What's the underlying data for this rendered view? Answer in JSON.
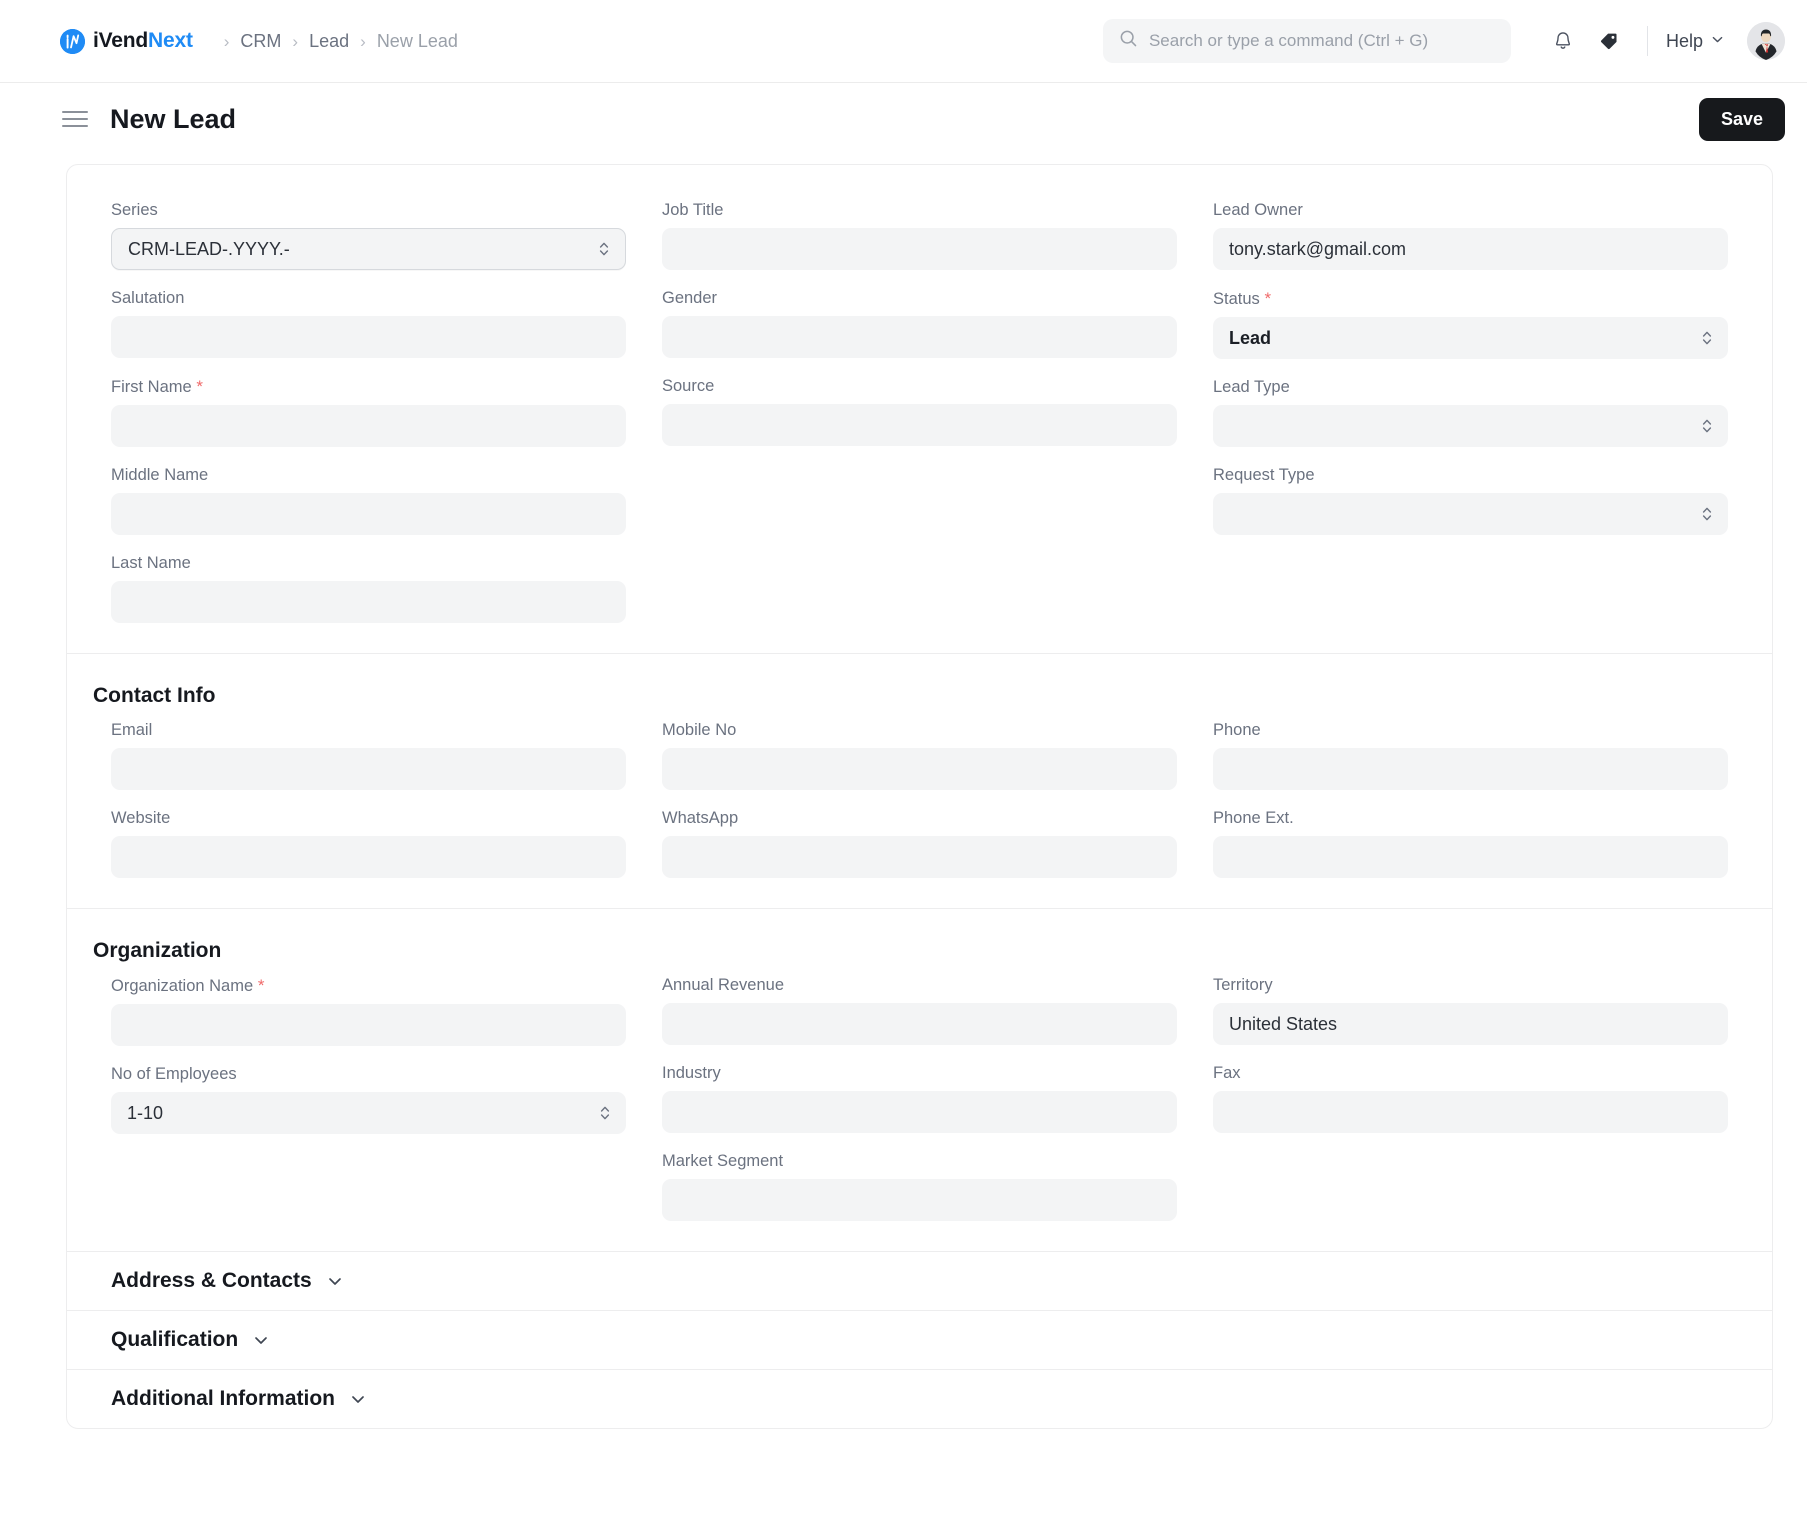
{
  "topnav": {
    "brand": {
      "dark": "iVend",
      "blue": "Next",
      "mark": "logo-icon"
    },
    "breadcrumbs": [
      {
        "label": "CRM",
        "current": false
      },
      {
        "label": "Lead",
        "current": false
      },
      {
        "label": "New Lead",
        "current": true
      }
    ],
    "separator": "›",
    "search": {
      "placeholder": "Search or type a command (Ctrl + G)",
      "value": "",
      "icon": "search-icon"
    },
    "notifications_icon": "bell-icon",
    "tags_icon": "tag-icon",
    "help": {
      "label": "Help",
      "icon": "chevron-down-icon"
    },
    "avatar": "user-avatar"
  },
  "titlebar": {
    "menu_icon": "hamburger-menu-icon",
    "title": "New Lead",
    "save_label": "Save"
  },
  "colors": {
    "accent": "#1f8bf5",
    "required": "#f06a6a",
    "field_bg": "#f3f4f5",
    "save_bg": "#17191c",
    "border": "#ededee",
    "label": "#6b7280"
  },
  "sections": [
    {
      "name": "details",
      "title": "",
      "columns": [
        {
          "fields": [
            {
              "label": "Series",
              "required": false,
              "type": "select",
              "value": "CRM-LEAD-.YYYY.-",
              "variant": "outlined",
              "bold": false
            },
            {
              "label": "Salutation",
              "required": false,
              "type": "text",
              "value": ""
            },
            {
              "label": "First Name",
              "required": true,
              "type": "text",
              "value": ""
            },
            {
              "label": "Middle Name",
              "required": false,
              "type": "text",
              "value": ""
            },
            {
              "label": "Last Name",
              "required": false,
              "type": "text",
              "value": ""
            }
          ]
        },
        {
          "fields": [
            {
              "label": "Job Title",
              "required": false,
              "type": "text",
              "value": ""
            },
            {
              "label": "Gender",
              "required": false,
              "type": "text",
              "value": ""
            },
            {
              "label": "Source",
              "required": false,
              "type": "text",
              "value": ""
            }
          ]
        },
        {
          "fields": [
            {
              "label": "Lead Owner",
              "required": false,
              "type": "text",
              "value": "tony.stark@gmail.com"
            },
            {
              "label": "Status",
              "required": true,
              "type": "select",
              "value": "Lead",
              "bold": true
            },
            {
              "label": "Lead Type",
              "required": false,
              "type": "select",
              "value": ""
            },
            {
              "label": "Request Type",
              "required": false,
              "type": "select",
              "value": ""
            }
          ]
        }
      ]
    },
    {
      "name": "contact-info",
      "title": "Contact Info",
      "columns": [
        {
          "fields": [
            {
              "label": "Email",
              "required": false,
              "type": "text",
              "value": ""
            },
            {
              "label": "Website",
              "required": false,
              "type": "text",
              "value": ""
            }
          ]
        },
        {
          "fields": [
            {
              "label": "Mobile No",
              "required": false,
              "type": "text",
              "value": ""
            },
            {
              "label": "WhatsApp",
              "required": false,
              "type": "text",
              "value": ""
            }
          ]
        },
        {
          "fields": [
            {
              "label": "Phone",
              "required": false,
              "type": "text",
              "value": ""
            },
            {
              "label": "Phone Ext.",
              "required": false,
              "type": "text",
              "value": ""
            }
          ]
        }
      ]
    },
    {
      "name": "organization",
      "title": "Organization",
      "columns": [
        {
          "fields": [
            {
              "label": "Organization Name",
              "required": true,
              "type": "text",
              "value": ""
            },
            {
              "label": "No of Employees",
              "required": false,
              "type": "select",
              "value": "1-10",
              "bold": false
            }
          ]
        },
        {
          "fields": [
            {
              "label": "Annual Revenue",
              "required": false,
              "type": "text",
              "value": ""
            },
            {
              "label": "Industry",
              "required": false,
              "type": "text",
              "value": ""
            },
            {
              "label": "Market Segment",
              "required": false,
              "type": "text",
              "value": ""
            }
          ]
        },
        {
          "fields": [
            {
              "label": "Territory",
              "required": false,
              "type": "text",
              "value": "United States"
            },
            {
              "label": "Fax",
              "required": false,
              "type": "text",
              "value": ""
            }
          ]
        }
      ]
    }
  ],
  "collapsibles": [
    {
      "title": "Address & Contacts",
      "expanded": false,
      "icon": "chevron-down-icon"
    },
    {
      "title": "Qualification",
      "expanded": false,
      "icon": "chevron-down-icon"
    },
    {
      "title": "Additional Information",
      "expanded": false,
      "icon": "chevron-down-icon"
    }
  ]
}
